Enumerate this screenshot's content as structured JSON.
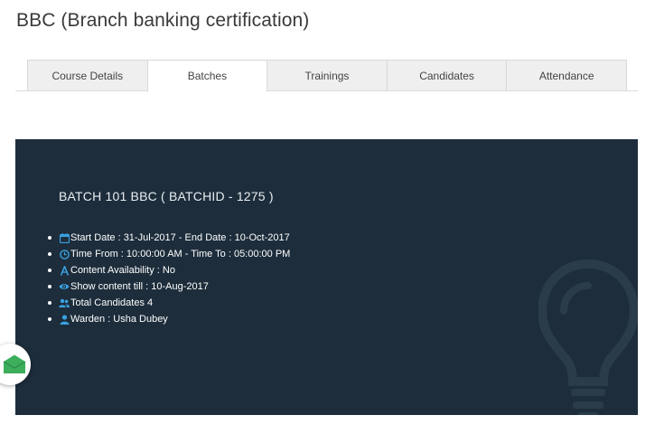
{
  "page": {
    "title": "BBC (Branch banking certification)"
  },
  "tabs": [
    {
      "label": "Course Details",
      "active": false
    },
    {
      "label": "Batches",
      "active": true
    },
    {
      "label": "Trainings",
      "active": false
    },
    {
      "label": "Candidates",
      "active": false
    },
    {
      "label": "Attendance",
      "active": false
    }
  ],
  "batch": {
    "title": "BATCH 101 BBC ( BATCHID - 1275 )",
    "details": [
      {
        "icon": "calendar-icon",
        "text": "Start Date : 31-Jul-2017 - End Date : 10-Oct-2017"
      },
      {
        "icon": "clock-icon",
        "text": "Time From : 10:00:00 AM - Time To : 05:00:00 PM"
      },
      {
        "icon": "font-icon",
        "text": "Content Availability : No"
      },
      {
        "icon": "eye-icon",
        "text": "Show content till : 10-Aug-2017"
      },
      {
        "icon": "users-icon",
        "text": "Total Candidates 4"
      },
      {
        "icon": "user-icon",
        "text": "Warden : Usha Dubey"
      }
    ]
  },
  "colors": {
    "panel_bg": "#1d2d3b",
    "icon_blue": "#3aa0e0",
    "fab_green": "#3cae5c"
  },
  "decorations": {
    "panel_background_icon": "lightbulb-icon",
    "floating_button_icon": "envelope-icon"
  }
}
